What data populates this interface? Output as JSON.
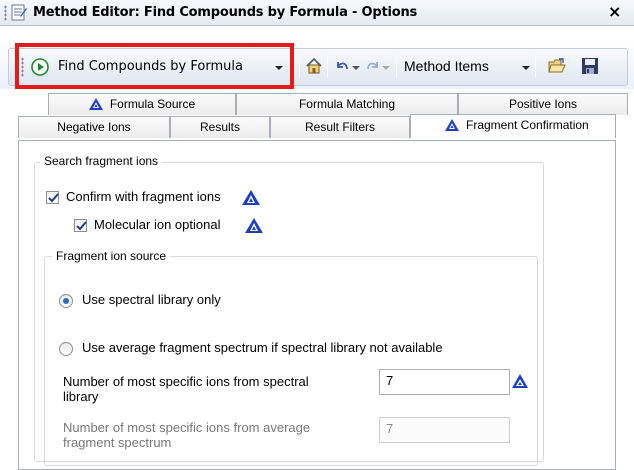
{
  "window": {
    "title": "Method Editor: Find Compounds by Formula - Options",
    "close_glyph": "×"
  },
  "toolbar": {
    "method_dropdown_label": "Find Compounds by Formula",
    "method_items_label": "Method Items",
    "icons": [
      "run-icon",
      "home-icon",
      "undo-icon",
      "redo-icon",
      "open-folder-icon",
      "save-icon"
    ]
  },
  "tabs": {
    "row1": [
      {
        "label": "Formula Source",
        "has_icon": true
      },
      {
        "label": "Formula Matching",
        "has_icon": false
      },
      {
        "label": "Positive Ions",
        "has_icon": false
      }
    ],
    "row2": [
      {
        "label": "Negative Ions",
        "has_icon": false
      },
      {
        "label": "Results",
        "has_icon": false
      },
      {
        "label": "Result Filters",
        "has_icon": false
      },
      {
        "label": "Fragment Confirmation",
        "has_icon": true,
        "active": true
      }
    ]
  },
  "panel": {
    "search_group_title": "Search fragment ions",
    "confirm_label": "Confirm with fragment ions",
    "confirm_checked": true,
    "molecular_label": "Molecular ion optional",
    "molecular_checked": true,
    "source_group_title": "Fragment ion source",
    "radio_library_label": "Use spectral library only",
    "radio_library_selected": true,
    "radio_average_label": "Use average fragment spectrum if spectral library not available",
    "radio_average_selected": false,
    "num_library_label_line1": "Number of most specific ions from spectral",
    "num_library_label_line2": "library",
    "num_library_value": "7",
    "num_average_label_line1": "Number of most specific ions from average",
    "num_average_label_line2": "fragment spectrum",
    "num_average_value": "7"
  },
  "colors": {
    "highlight_box": "#e41b1b",
    "icon_blue": "#1c3fc4",
    "radio_blue": "#2b6bc4"
  }
}
